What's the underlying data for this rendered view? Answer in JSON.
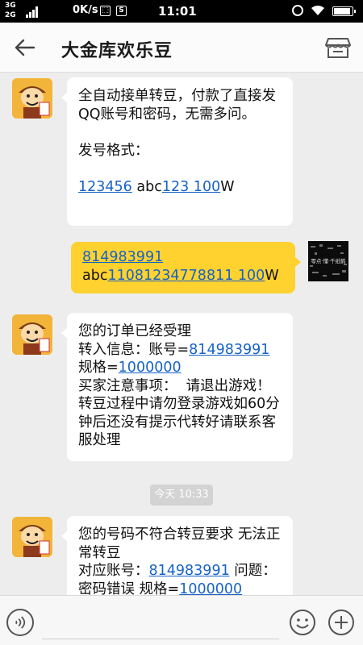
{
  "status_bar": {
    "network_top": "3G",
    "network_bottom": "2G",
    "speed": "0K/s",
    "time": "11:01",
    "battery_level": 0.85
  },
  "header": {
    "title": "大金库欢乐豆"
  },
  "messages": [
    {
      "sender": "contact",
      "parts": [
        "全自动接单转豆，付款了直接发QQ账号和密码，无需多问。",
        "发号格式：",
        "123456",
        " abc",
        "123 100",
        "W"
      ]
    },
    {
      "sender": "me",
      "parts": [
        "814983991",
        "abc",
        "11081234778811 100",
        "W"
      ]
    },
    {
      "sender": "contact",
      "parts": [
        "您的订单已经受理",
        "转入信息：账号=",
        "814983991",
        "规格=",
        "1000000",
        "买家注意事项：  请退出游戏！转豆过程中请勿登录游戏如60分钟后还没有提示代转好请联系客服处理"
      ]
    },
    {
      "sender": "contact",
      "parts": [
        "您的号码不符合转豆要求 无法正常转豆",
        "对应账号：",
        "814983991",
        " 问题：",
        "密码错误 规格=",
        "1000000"
      ]
    }
  ],
  "timestamp": "今天 10:33",
  "my_avatar_text": "零点·懂·千纸鹤",
  "input": {
    "placeholder": ""
  },
  "colors": {
    "incoming_bubble": "#ffffff",
    "outgoing_bubble": "#ffd230",
    "link": "#1763c7",
    "background": "#ededed"
  },
  "icons": [
    "back-arrow-icon",
    "shop-icon",
    "voice-icon",
    "emoji-icon",
    "plus-icon",
    "alarm-icon",
    "wifi-icon",
    "battery-icon",
    "signal-icon"
  ]
}
